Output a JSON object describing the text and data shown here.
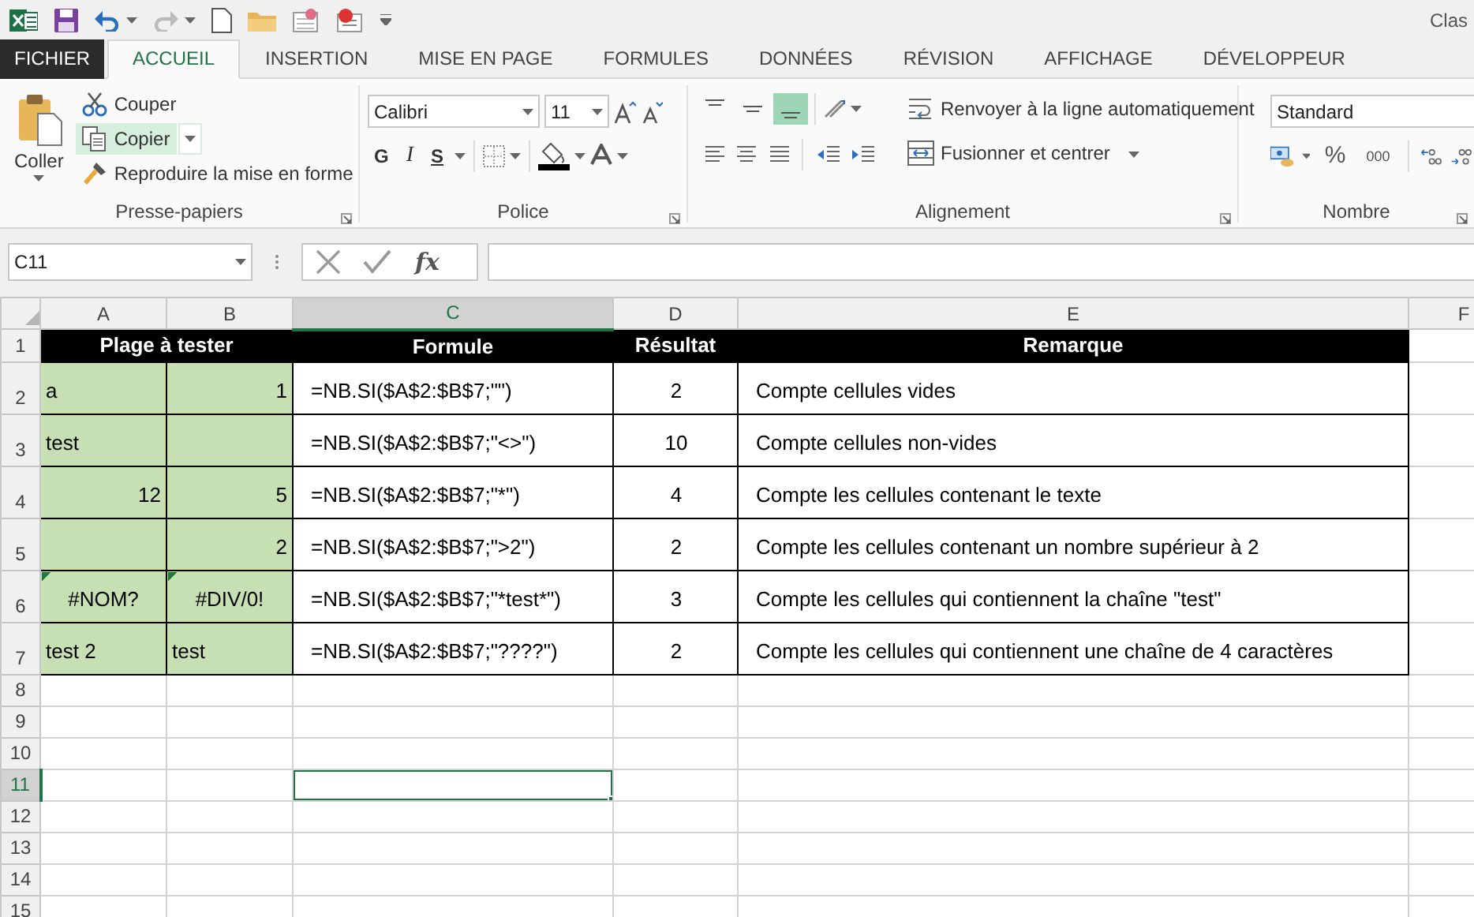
{
  "window": {
    "title": "Clas"
  },
  "ribbon_tabs": [
    {
      "label": "FICHIER",
      "kind": "file",
      "selected": false
    },
    {
      "label": "ACCUEIL",
      "kind": "tab",
      "selected": true
    },
    {
      "label": "INSERTION",
      "kind": "tab",
      "selected": false
    },
    {
      "label": "MISE EN PAGE",
      "kind": "tab",
      "selected": false
    },
    {
      "label": "FORMULES",
      "kind": "tab",
      "selected": false
    },
    {
      "label": "DONNÉES",
      "kind": "tab",
      "selected": false
    },
    {
      "label": "RÉVISION",
      "kind": "tab",
      "selected": false
    },
    {
      "label": "AFFICHAGE",
      "kind": "tab",
      "selected": false
    },
    {
      "label": "DÉVELOPPEUR",
      "kind": "tab",
      "selected": false
    }
  ],
  "clipboard": {
    "paste": "Coller",
    "cut": "Couper",
    "copy": "Copier",
    "copy_highlighted": true,
    "format_painter": "Reproduire la mise en forme",
    "label": "Presse-papiers"
  },
  "font": {
    "name": "Calibri",
    "size": "11",
    "bold": "G",
    "italic": "I",
    "underline": "S",
    "label": "Police"
  },
  "alignment": {
    "align_buttons": [
      {
        "kind": "top",
        "selected": false
      },
      {
        "kind": "middle",
        "selected": false
      },
      {
        "kind": "bottom",
        "selected": true
      }
    ],
    "wrap_text": "Renvoyer à la ligne automatiquement",
    "merge_center": "Fusionner et centrer",
    "label": "Alignement"
  },
  "number": {
    "format": "Standard",
    "percent": "%",
    "thousands": "000",
    "label": "Nombre"
  },
  "formula_bar": {
    "name_box": "C11",
    "function_label": "fx"
  },
  "sheet": {
    "columns": [
      {
        "label": "A",
        "selected": false
      },
      {
        "label": "B",
        "selected": false
      },
      {
        "label": "C",
        "selected": true
      },
      {
        "label": "D",
        "selected": false
      },
      {
        "label": "E",
        "selected": false
      },
      {
        "label": "F",
        "selected": false
      }
    ],
    "rows": [
      {
        "label": "1",
        "selected": false,
        "cells": [
          {
            "text": "Plage à tester",
            "kind": "header",
            "colspan": 2
          },
          {
            "text": "Formule",
            "kind": "header"
          },
          {
            "text": "Résultat",
            "kind": "header"
          },
          {
            "text": "Remarque",
            "kind": "header"
          }
        ]
      },
      {
        "label": "2",
        "selected": false,
        "cells": [
          {
            "text": "a",
            "kind": "text"
          },
          {
            "text": "1",
            "kind": "number"
          },
          {
            "text": "=NB.SI($A$2:$B$7;\"\")",
            "kind": "formula"
          },
          {
            "text": "2",
            "kind": "result"
          },
          {
            "text": "Compte cellules vides",
            "kind": "remark"
          }
        ]
      },
      {
        "label": "3",
        "selected": false,
        "cells": [
          {
            "text": "test",
            "kind": "text"
          },
          {
            "kind": "blank"
          },
          {
            "text": "=NB.SI($A$2:$B$7;\"<>\")",
            "kind": "formula"
          },
          {
            "text": "10",
            "kind": "result"
          },
          {
            "text": "Compte cellules non-vides",
            "kind": "remark"
          }
        ]
      },
      {
        "label": "4",
        "selected": false,
        "cells": [
          {
            "text": "12",
            "kind": "number"
          },
          {
            "text": "5",
            "kind": "number"
          },
          {
            "text": "=NB.SI($A$2:$B$7;\"*\")",
            "kind": "formula"
          },
          {
            "text": "4",
            "kind": "result"
          },
          {
            "text": "Compte les cellules contenant le texte",
            "kind": "remark"
          }
        ]
      },
      {
        "label": "5",
        "selected": false,
        "cells": [
          {
            "kind": "blank"
          },
          {
            "text": "2",
            "kind": "number"
          },
          {
            "text": "=NB.SI($A$2:$B$7;\">2\")",
            "kind": "formula"
          },
          {
            "text": "2",
            "kind": "result"
          },
          {
            "text": "Compte les cellules contenant un nombre supérieur à 2",
            "kind": "remark"
          }
        ]
      },
      {
        "label": "6",
        "selected": false,
        "cells": [
          {
            "text": "#NOM?",
            "kind": "error",
            "flag": true
          },
          {
            "text": "#DIV/0!",
            "kind": "error",
            "flag": true
          },
          {
            "text": "=NB.SI($A$2:$B$7;\"*test*\")",
            "kind": "formula"
          },
          {
            "text": "3",
            "kind": "result"
          },
          {
            "text": "Compte les cellules qui contiennent la chaîne \"test\"",
            "kind": "remark"
          }
        ]
      },
      {
        "label": "7",
        "selected": false,
        "cells": [
          {
            "text": "test 2",
            "kind": "text"
          },
          {
            "text": "test",
            "kind": "text"
          },
          {
            "text": "=NB.SI($A$2:$B$7;\"????\")",
            "kind": "formula"
          },
          {
            "text": "2",
            "kind": "result"
          },
          {
            "text": "Compte les cellules qui contiennent une chaîne de 4 caractères",
            "kind": "remark"
          }
        ]
      },
      {
        "label": "8",
        "selected": false,
        "cells": []
      },
      {
        "label": "9",
        "selected": false,
        "cells": []
      },
      {
        "label": "10",
        "selected": false,
        "cells": []
      },
      {
        "label": "11",
        "selected": true,
        "cells": []
      },
      {
        "label": "12",
        "selected": false,
        "cells": []
      },
      {
        "label": "13",
        "selected": false,
        "cells": []
      },
      {
        "label": "14",
        "selected": false,
        "cells": []
      },
      {
        "label": "15",
        "selected": false,
        "cells": []
      }
    ]
  }
}
